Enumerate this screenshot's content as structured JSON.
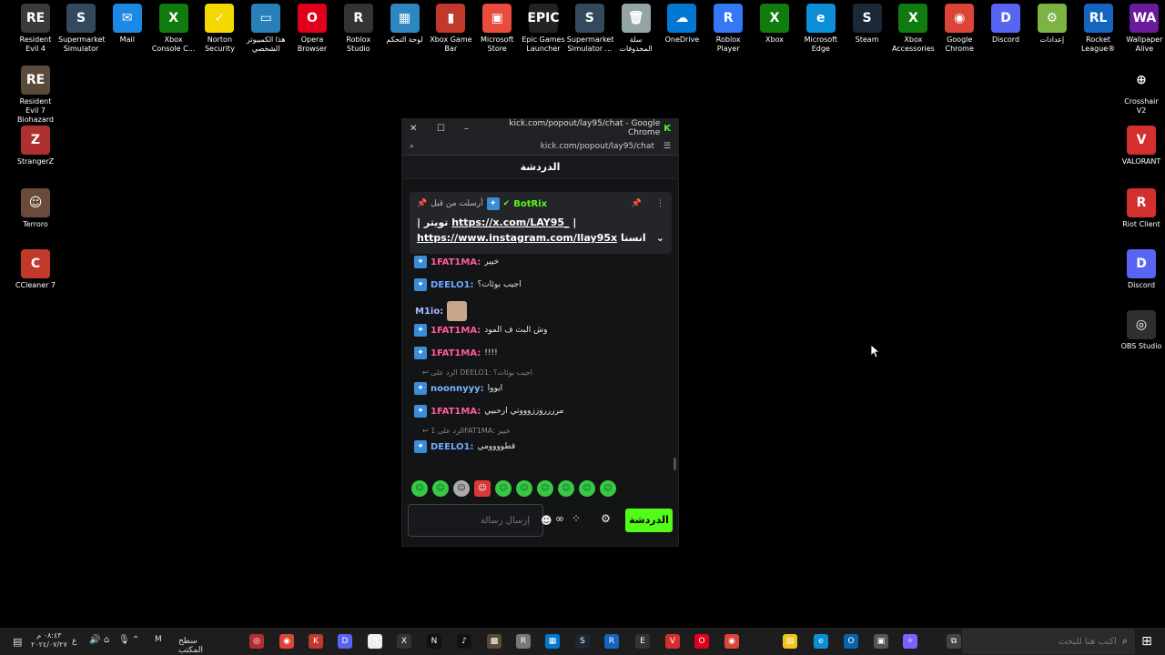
{
  "desktop_left_icons": [
    {
      "label": "Resident Evil 4",
      "color": "#3a3a3a",
      "glyph": "RE"
    },
    {
      "label": "Resident Evil 7 Biohazard",
      "color": "#5a4a3a",
      "glyph": "RE"
    },
    {
      "label": "StrangerZ",
      "color": "#b03030",
      "glyph": "Z"
    },
    {
      "label": "Terroro",
      "color": "#6a4a3a",
      "glyph": "☺"
    },
    {
      "label": "CCleaner 7",
      "color": "#c0392b",
      "glyph": "C"
    }
  ],
  "desktop_top_icons": [
    {
      "label": "Supermarket Simulator",
      "color": "#34495e",
      "glyph": "S"
    },
    {
      "label": "Mail",
      "color": "#1e88e5",
      "glyph": "✉"
    },
    {
      "label": "Xbox Console C...",
      "color": "#107c10",
      "glyph": "X"
    },
    {
      "label": "Norton Security",
      "color": "#f5d800",
      "glyph": "✓"
    },
    {
      "label": "هذا الكمبيوتر الشخصي",
      "color": "#2980b9",
      "glyph": "▭"
    },
    {
      "label": "Opera Browser",
      "color": "#e0001b",
      "glyph": "O"
    },
    {
      "label": "Roblox Studio",
      "color": "#333333",
      "glyph": "R"
    },
    {
      "label": "لوحة التحكم",
      "color": "#2e86c1",
      "glyph": "▦"
    },
    {
      "label": "Xbox Game Bar",
      "color": "#c0392b",
      "glyph": "▮"
    },
    {
      "label": "Microsoft Store",
      "color": "#e74c3c",
      "glyph": "▣"
    },
    {
      "label": "Epic Games Launcher",
      "color": "#222222",
      "glyph": "EPIC"
    },
    {
      "label": "Supermarket Simulator ...",
      "color": "#34495e",
      "glyph": "S"
    },
    {
      "label": "سلة المحذوفات",
      "color": "#95a5a6",
      "glyph": "🗑"
    },
    {
      "label": "OneDrive",
      "color": "#0078d4",
      "glyph": "☁"
    },
    {
      "label": "Roblox Player",
      "color": "#3478f6",
      "glyph": "R"
    },
    {
      "label": "Xbox",
      "color": "#107c10",
      "glyph": "X"
    },
    {
      "label": "Microsoft Edge",
      "color": "#0c8fd6",
      "glyph": "e"
    },
    {
      "label": "Steam",
      "color": "#1b2838",
      "glyph": "S"
    },
    {
      "label": "Xbox Accessories",
      "color": "#107c10",
      "glyph": "X"
    },
    {
      "label": "Google Chrome",
      "color": "#db4437",
      "glyph": "◉"
    },
    {
      "label": "Discord",
      "color": "#5865f2",
      "glyph": "D"
    },
    {
      "label": "إعدادات",
      "color": "#7cb342",
      "glyph": "⚙"
    },
    {
      "label": "Rocket League®",
      "color": "#1565c0",
      "glyph": "RL"
    },
    {
      "label": "Wallpaper Alive",
      "color": "#6a1b9a",
      "glyph": "WA"
    }
  ],
  "desktop_right_icons": [
    {
      "label": "Crosshair V2",
      "color": "#000000",
      "glyph": "⊕"
    },
    {
      "label": "VALORANT",
      "color": "#d32f2f",
      "glyph": "V"
    },
    {
      "label": "Riot Client",
      "color": "#d32f2f",
      "glyph": "R"
    },
    {
      "label": "Discord",
      "color": "#5865f2",
      "glyph": "D"
    },
    {
      "label": "OBS Studio",
      "color": "#302e31",
      "glyph": "◎"
    }
  ],
  "window": {
    "title": "kick.com/popout/lay95/chat - Google Chrome",
    "url": "kick.com/popout/lay95/chat",
    "chat_header": "الدردشة"
  },
  "pinned": {
    "sent_before": "أرسلت من قبل",
    "bot_name": "BotRix",
    "line1_prefix": "تويتر",
    "line1_link": "https://x.com/LAY95_",
    "line1_suffix": "|",
    "line2_link": "https://www.instagram.com/llay95x",
    "line2_suffix": "انستا"
  },
  "messages": [
    {
      "user": "1FAT1MA",
      "color": "#ff5c9d",
      "text": "خيير",
      "badge": true
    },
    {
      "user": "DEELO1",
      "color": "#6fa8ff",
      "text": "اجيب بوئات؟",
      "badge": true
    },
    {
      "user": "M1io",
      "color": "#a7b8ff",
      "text": "",
      "badge": false
    },
    {
      "user": "1FAT1MA",
      "color": "#ff5c9d",
      "text": "وش البث ف المود",
      "badge": true
    },
    {
      "user": "1FAT1MA",
      "color": "#ff5c9d",
      "text": "!!!!",
      "badge": true
    },
    {
      "user": "noonnyyy",
      "color": "#7fb3ff",
      "text": "ايووا",
      "badge": true
    },
    {
      "user": "1FAT1MA",
      "color": "#ff5c9d",
      "text": "مرررروززوووتي ارحبيي",
      "badge": true
    },
    {
      "user": "DEELO1",
      "color": "#6fa8ff",
      "text": "قطوووومي",
      "badge": true
    }
  ],
  "replies": [
    {
      "text": "الرد على DEELO1: اجيب بوئات؟"
    },
    {
      "text": "الرد على 1FAT1MA: خيير"
    }
  ],
  "composer": {
    "placeholder": "إرسال رسالة",
    "send_label": "الدردشة"
  },
  "taskbar": {
    "search_placeholder": "اكتب هنا للبحث",
    "time": "٠٨:٤٣ م",
    "date": "٢٠٢٤/٠٧/٢٧",
    "desktop_label": "سطح المكتب",
    "lang": "ع"
  }
}
